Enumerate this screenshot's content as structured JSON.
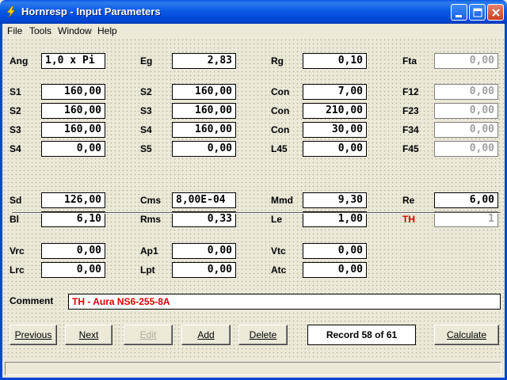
{
  "window": {
    "title": "Hornresp - Input Parameters"
  },
  "menu": [
    "File",
    "Tools",
    "Window",
    "Help"
  ],
  "rows": [
    [
      [
        "Ang",
        "1,0 x Pi"
      ],
      [
        "Eg",
        "2,83"
      ],
      [
        "Rg",
        "0,10"
      ],
      [
        "Fta",
        "0,00"
      ]
    ],
    [
      [
        "S1",
        "160,00"
      ],
      [
        "S2",
        "160,00"
      ],
      [
        "Con",
        "7,00"
      ],
      [
        "F12",
        "0,00"
      ]
    ],
    [
      [
        "S2",
        "160,00"
      ],
      [
        "S3",
        "160,00"
      ],
      [
        "Con",
        "210,00"
      ],
      [
        "F23",
        "0,00"
      ]
    ],
    [
      [
        "S3",
        "160,00"
      ],
      [
        "S4",
        "160,00"
      ],
      [
        "Con",
        "30,00"
      ],
      [
        "F34",
        "0,00"
      ]
    ],
    [
      [
        "S4",
        "0,00"
      ],
      [
        "S5",
        "0,00"
      ],
      [
        "L45",
        "0,00"
      ],
      [
        "F45",
        "0,00"
      ]
    ],
    [
      [
        "Sd",
        "126,00"
      ],
      [
        "Cms",
        "8,00E-04"
      ],
      [
        "Mmd",
        "9,30"
      ],
      [
        "Re",
        "6,00"
      ]
    ],
    [
      [
        "Bl",
        "6,10"
      ],
      [
        "Rms",
        "0,33"
      ],
      [
        "Le",
        "1,00"
      ],
      [
        "TH",
        "1"
      ]
    ],
    [
      [
        "Vrc",
        "0,00"
      ],
      [
        "Ap1",
        "0,00"
      ],
      [
        "Vtc",
        "0,00"
      ]
    ],
    [
      [
        "Lrc",
        "0,00"
      ],
      [
        "Lpt",
        "0,00"
      ],
      [
        "Atc",
        "0,00"
      ]
    ]
  ],
  "comment": {
    "label": "Comment",
    "value": "TH - Aura NS6-255-8A"
  },
  "buttons": {
    "previous": "Previous",
    "next": "Next",
    "edit": "Edit",
    "add": "Add",
    "delete": "Delete",
    "calculate": "Calculate"
  },
  "record": "Record 58 of 61",
  "colors": {
    "titlebar": "#0a5ae6",
    "comment_text": "#e00000",
    "th_label": "#e00000",
    "disabled_text": "#a0a0a0"
  },
  "icons": {
    "app": "lightning-bolt-icon",
    "minimize": "minimize-icon",
    "maximize": "maximize-icon",
    "close": "close-icon"
  }
}
